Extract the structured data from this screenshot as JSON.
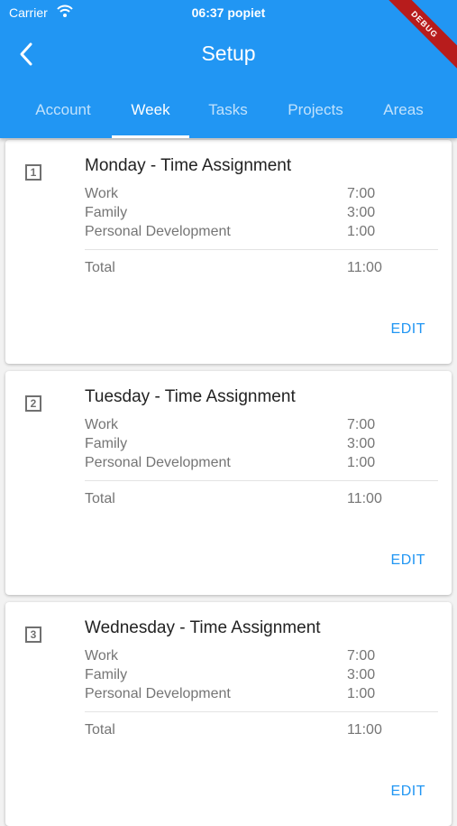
{
  "status_bar": {
    "carrier": "Carrier",
    "time": "06:37 popiet",
    "debug": "DEBUG"
  },
  "app_bar": {
    "title": "Setup"
  },
  "tabs": [
    {
      "label": "Account"
    },
    {
      "label": "Week"
    },
    {
      "label": "Tasks"
    },
    {
      "label": "Projects"
    },
    {
      "label": "Areas"
    }
  ],
  "days": [
    {
      "number": "1",
      "title": "Monday - Time Assignment",
      "items": [
        {
          "label": "Work",
          "value": "7:00"
        },
        {
          "label": "Family",
          "value": "3:00"
        },
        {
          "label": "Personal Development",
          "value": "1:00"
        }
      ],
      "total_label": "Total",
      "total_value": "11:00",
      "edit_label": "EDIT"
    },
    {
      "number": "2",
      "title": "Tuesday - Time Assignment",
      "items": [
        {
          "label": "Work",
          "value": "7:00"
        },
        {
          "label": "Family",
          "value": "3:00"
        },
        {
          "label": "Personal Development",
          "value": "1:00"
        }
      ],
      "total_label": "Total",
      "total_value": "11:00",
      "edit_label": "EDIT"
    },
    {
      "number": "3",
      "title": "Wednesday - Time Assignment",
      "items": [
        {
          "label": "Work",
          "value": "7:00"
        },
        {
          "label": "Family",
          "value": "3:00"
        },
        {
          "label": "Personal Development",
          "value": "1:00"
        }
      ],
      "total_label": "Total",
      "total_value": "11:00",
      "edit_label": "EDIT"
    }
  ],
  "colors": {
    "primary": "#2196f3",
    "debug_ribbon": "#b71c1c"
  }
}
